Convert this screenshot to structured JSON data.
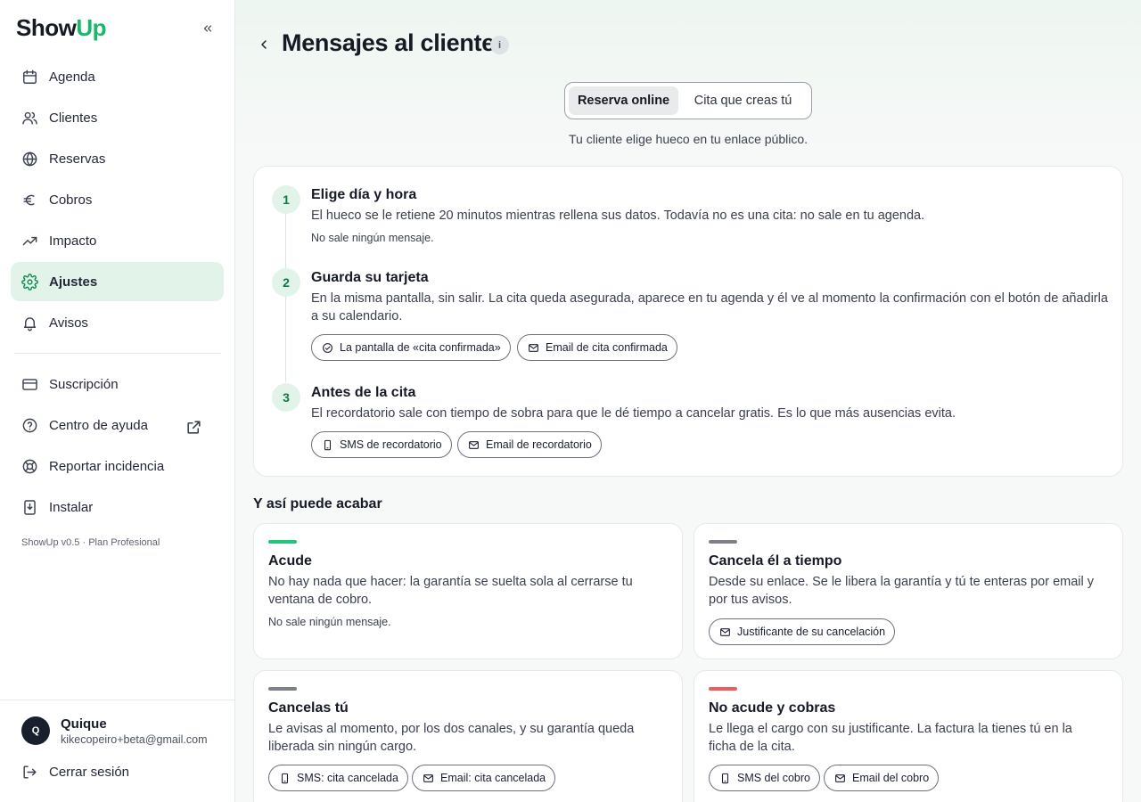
{
  "sidebar": {
    "logo_show": "Show",
    "logo_up": "Up",
    "nav": [
      {
        "label": "Agenda"
      },
      {
        "label": "Clientes"
      },
      {
        "label": "Reservas"
      },
      {
        "label": "Cobros"
      },
      {
        "label": "Impacto"
      },
      {
        "label": "Ajustes"
      },
      {
        "label": "Avisos"
      }
    ],
    "secondary": [
      {
        "label": "Suscripción"
      },
      {
        "label": "Centro de ayuda"
      },
      {
        "label": "Reportar incidencia"
      },
      {
        "label": "Instalar"
      }
    ],
    "version": "ShowUp v0.5 · Plan Profesional",
    "user": {
      "initial": "Q",
      "name": "Quique",
      "email": "kikecopeiro+beta@gmail.com"
    },
    "logout": "Cerrar sesión"
  },
  "header": {
    "title": "Mensajes al cliente",
    "info": "i"
  },
  "tabs": {
    "active": "Reserva online",
    "inactive": "Cita que creas tú"
  },
  "tab_caption": "Tu cliente elige hueco en tu enlace público.",
  "steps": [
    {
      "num": "1",
      "title": "Elige día y hora",
      "desc": "El hueco se le retiene 20 minutos mientras rellena sus datos. Todavía no es una cita: no sale en tu agenda.",
      "note": "No sale ningún mensaje."
    },
    {
      "num": "2",
      "title": "Guarda su tarjeta",
      "desc": "En la misma pantalla, sin salir. La cita queda asegurada, aparece en tu agenda y él ve al momento la confirmación con el botón de añadirla a su calendario.",
      "chips": [
        "La pantalla de «cita confirmada»",
        "Email de cita confirmada"
      ]
    },
    {
      "num": "3",
      "title": "Antes de la cita",
      "desc": "El recordatorio sale con tiempo de sobra para que le dé tiempo a cancelar gratis. Es lo que más ausencias evita.",
      "chips": [
        "SMS de recordatorio",
        "Email de recordatorio"
      ]
    }
  ],
  "outcomes_title": "Y así puede acabar",
  "outcomes": [
    {
      "title": "Acude",
      "desc": "No hay nada que hacer: la garantía se suelta sola al cerrarse tu ventana de cobro.",
      "note": "No sale ningún mensaje.",
      "color": "#1fc77a"
    },
    {
      "title": "Cancela él a tiempo",
      "desc": "Desde su enlace. Se le libera la garantía y tú te enteras por email y por tus avisos.",
      "chips": [
        "Justificante de su cancelación"
      ],
      "color": "#7b808a"
    },
    {
      "title": "Cancelas tú",
      "desc": "Le avisas al momento, por los dos canales, y su garantía queda liberada sin ningún cargo.",
      "chips": [
        "SMS: cita cancelada",
        "Email: cita cancelada"
      ],
      "color": "#7b808a"
    },
    {
      "title": "No acude y cobras",
      "desc": "Le llega el cargo con su justificante. La factura la tienes tú en la ficha de la cita.",
      "chips": [
        "SMS del cobro",
        "Email del cobro"
      ],
      "color": "#ef5b60"
    }
  ]
}
